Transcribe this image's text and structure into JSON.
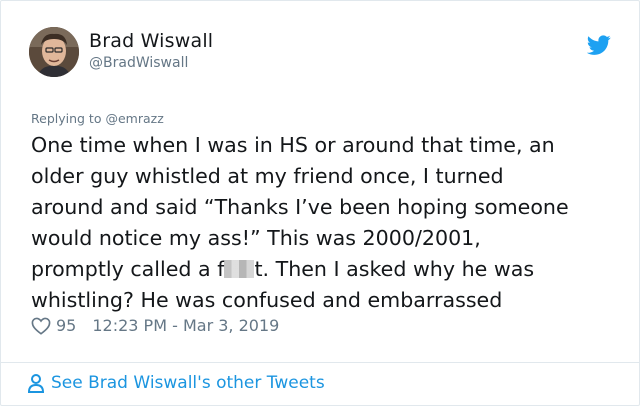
{
  "author": {
    "name": "Brad Wiswall",
    "handle": "@BradWiswall"
  },
  "replying": {
    "prefix": "Replying to",
    "to": "@emrazz"
  },
  "tweet": {
    "lines": [
      "One time when I was in HS or around that time, an",
      "older guy whistled at my friend once, I turned",
      "around and said “Thanks I’ve been hoping someone",
      "would notice my ass!” This was 2000/2001,",
      "promptly called a f",
      "t. Then I asked why he was",
      "whistling? He was confused and embarrassed"
    ]
  },
  "meta": {
    "likes": "95",
    "timestamp": "12:23 PM - Mar 3, 2019"
  },
  "footer": {
    "link_text": "See Brad Wiswall's other Tweets"
  },
  "icons": {
    "brand": "twitter-bird-icon",
    "like": "heart-icon",
    "profile": "person-icon"
  },
  "colors": {
    "brand_blue": "#1da1f2",
    "link_blue": "#1b95e0",
    "secondary_text": "#657786",
    "primary_text": "#14171a",
    "border": "#e1e8ed"
  }
}
